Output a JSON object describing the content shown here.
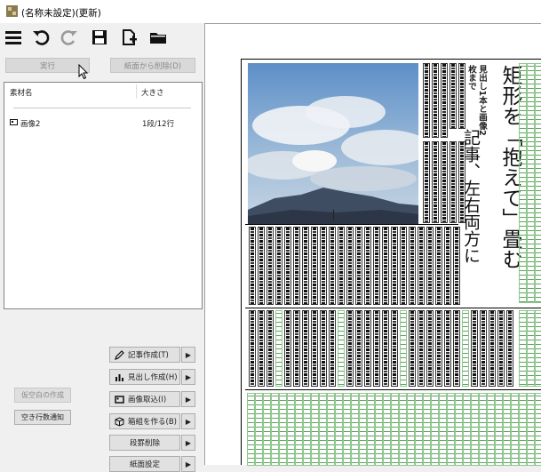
{
  "window": {
    "title": "(名称未設定)(更新)"
  },
  "toolbar": {
    "icons": [
      "menu-icon",
      "undo-icon",
      "redo-icon",
      "save-icon",
      "new-page-icon",
      "folder-icon"
    ]
  },
  "buttons": {
    "execute": "実行",
    "remove_from_page": "紙面から削除(D)"
  },
  "material_list": {
    "columns": [
      "素材名",
      "大きさ"
    ],
    "rows": [
      {
        "name": "画像2",
        "size": "1段/12行"
      }
    ]
  },
  "actions": [
    {
      "label": "記事作成(T)",
      "icon": "pencil-icon"
    },
    {
      "label": "見出し作成(H)",
      "icon": "bar-chart-icon"
    },
    {
      "label": "画像取込(I)",
      "icon": "image-icon"
    },
    {
      "label": "箱組を作る(B)",
      "icon": "box-icon"
    },
    {
      "label": "段罫削除",
      "icon": ""
    },
    {
      "label": "紙面設定",
      "icon": ""
    }
  ],
  "left_buttons": {
    "temp_blank": "仮空白の作成",
    "blank_lines_notice": "空き行数通知"
  },
  "page": {
    "headline_main": "矩形を「抱えて」畳む",
    "headline_second": "記事、左右両方に",
    "headline_sub": "見出し1本と画像2枚まで"
  },
  "colors": {
    "guide": "#5ca65c",
    "accent": "#adadad"
  }
}
